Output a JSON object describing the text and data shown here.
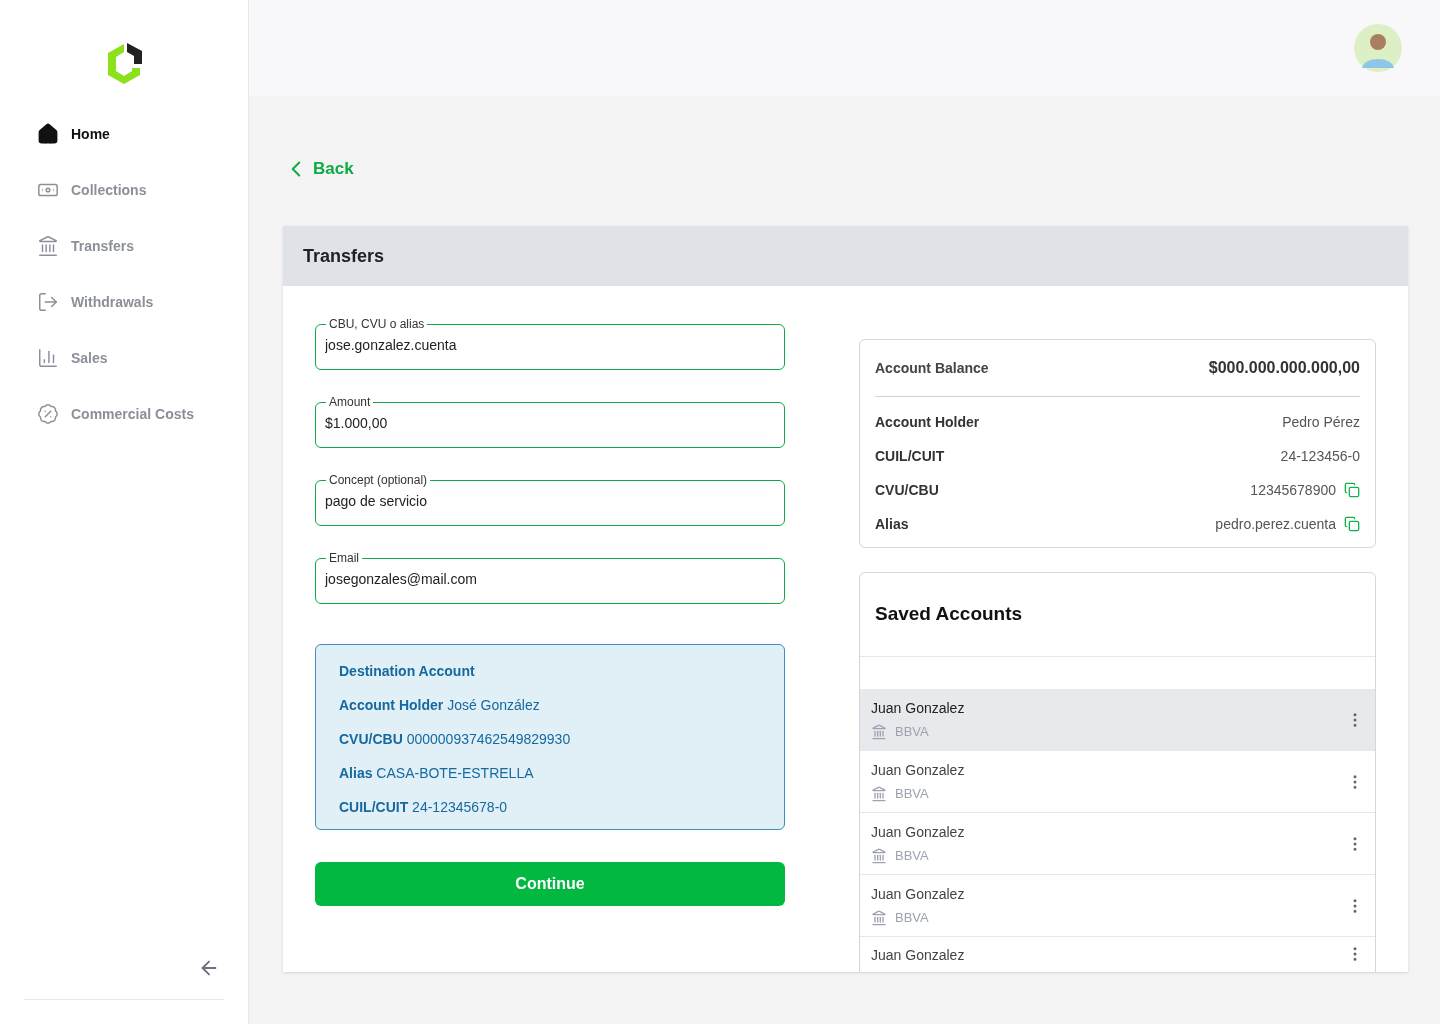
{
  "sidebar": {
    "items": [
      {
        "kind": "home",
        "label": "Home",
        "selected": true
      },
      {
        "kind": "collections",
        "label": "Collections",
        "selected": false
      },
      {
        "kind": "transfers",
        "label": "Transfers",
        "selected": false
      },
      {
        "kind": "withdrawals",
        "label": "Withdrawals",
        "selected": false
      },
      {
        "kind": "sales",
        "label": "Sales",
        "selected": false
      },
      {
        "kind": "costs",
        "label": "Commercial Costs",
        "selected": false
      }
    ]
  },
  "back": "Back",
  "panel": {
    "title": "Transfers",
    "fields": [
      {
        "label": "CBU, CVU o alias",
        "value": "jose.gonzalez.cuenta"
      },
      {
        "label": "Amount",
        "value": "$1.000,00"
      },
      {
        "label": "Concept (optional)",
        "value": "pago de servicio"
      },
      {
        "label": "Email",
        "value": "josegonzales@mail.com"
      }
    ],
    "destination": {
      "title": "Destination Account",
      "lines": [
        {
          "label": "Account Holder",
          "value": "José González"
        },
        {
          "label": "CVU/CBU",
          "value": "000000937462549829930"
        },
        {
          "label": "Alias",
          "value": "CASA-BOTE-ESTRELLA"
        },
        {
          "label": "CUIL/CUIT",
          "value": "24-12345678-0"
        }
      ]
    },
    "continue": "Continue",
    "balance": {
      "label": "Account Balance",
      "value": "$000.000.000.000,00",
      "rows": [
        {
          "kind": "plain",
          "label": "Account Holder",
          "value": "Pedro Pérez"
        },
        {
          "kind": "plain",
          "label": "CUIL/CUIT",
          "value": "24-123456-0"
        },
        {
          "kind": "copyable",
          "label": "CVU/CBU",
          "value": "12345678900"
        },
        {
          "kind": "copyable",
          "label": "Alias",
          "value": "pedro.perez.cuenta"
        }
      ]
    },
    "saved": {
      "title": "Saved Accounts",
      "items": [
        {
          "name": "Juan Gonzalez",
          "bank": "BBVA",
          "selected": true
        },
        {
          "name": "Juan Gonzalez",
          "bank": "BBVA",
          "selected": false
        },
        {
          "name": "Juan Gonzalez",
          "bank": "BBVA",
          "selected": false
        },
        {
          "name": "Juan Gonzalez",
          "bank": "BBVA",
          "selected": false
        },
        {
          "name": "Juan Gonzalez",
          "selected": false
        }
      ]
    }
  }
}
